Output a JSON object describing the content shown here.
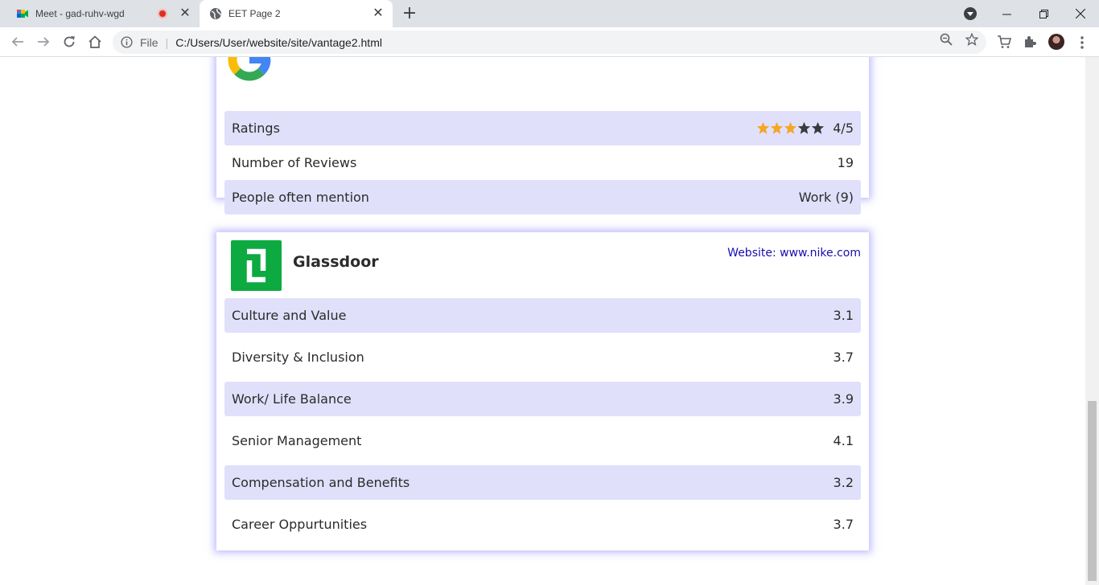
{
  "browser": {
    "tabs": [
      {
        "title": "Meet - gad-ruhv-wgd",
        "active": false,
        "recording": true
      },
      {
        "title": "EET Page 2",
        "active": true,
        "recording": false
      }
    ],
    "address": {
      "scheme": "File",
      "url": "C:/Users/User/website/site/vantage2.html"
    }
  },
  "google_card": {
    "rows": [
      {
        "label": "Ratings",
        "value": "4/5",
        "stars_filled": 3,
        "stars_total": 5
      },
      {
        "label": "Number of Reviews",
        "value": "19"
      },
      {
        "label": "People often mention",
        "value": "Work (9)"
      }
    ]
  },
  "glassdoor_card": {
    "name": "Glassdoor",
    "website": "Website: www.nike.com",
    "rows": [
      {
        "label": "Culture and Value",
        "value": "3.1"
      },
      {
        "label": "Diversity & Inclusion",
        "value": "3.7"
      },
      {
        "label": "Work/ Life Balance",
        "value": "3.9"
      },
      {
        "label": "Senior Management",
        "value": "4.1"
      },
      {
        "label": "Compensation and Benefits",
        "value": "3.2"
      },
      {
        "label": "Career Oppurtunities",
        "value": "3.7"
      }
    ]
  },
  "colors": {
    "row_shade": "#e0e0fb",
    "star_filled": "#f5a623",
    "star_empty": "#3a3a3a",
    "link": "#1a0dab",
    "glassdoor_green": "#0caa41"
  }
}
